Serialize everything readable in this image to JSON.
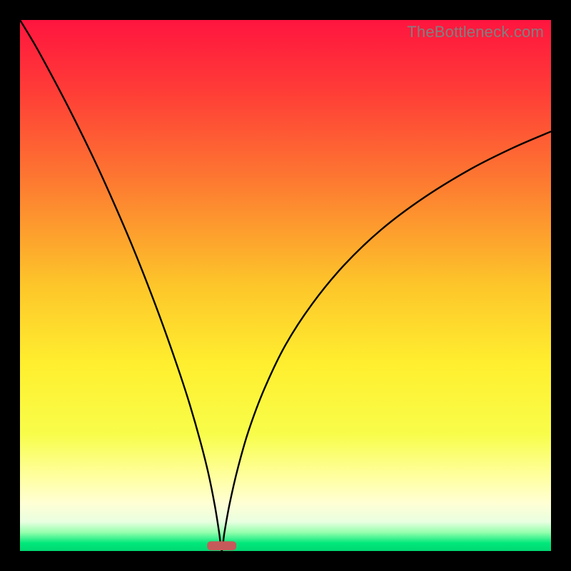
{
  "watermark": "TheBottleneck.com",
  "chart_data": {
    "type": "line",
    "title": "",
    "xlabel": "",
    "ylabel": "",
    "xlim": [
      0,
      1
    ],
    "ylim": [
      0,
      1
    ],
    "background_gradient": {
      "stops": [
        {
          "offset": 0.0,
          "color": "#ff153f"
        },
        {
          "offset": 0.13,
          "color": "#ff3b37"
        },
        {
          "offset": 0.3,
          "color": "#fd7831"
        },
        {
          "offset": 0.5,
          "color": "#fdc62a"
        },
        {
          "offset": 0.65,
          "color": "#ffef2f"
        },
        {
          "offset": 0.78,
          "color": "#f8fd4a"
        },
        {
          "offset": 0.86,
          "color": "#ffffa0"
        },
        {
          "offset": 0.91,
          "color": "#ffffd4"
        },
        {
          "offset": 0.945,
          "color": "#e9ffe0"
        },
        {
          "offset": 0.965,
          "color": "#95ffad"
        },
        {
          "offset": 0.985,
          "color": "#00e87a"
        },
        {
          "offset": 1.0,
          "color": "#00d873"
        }
      ]
    },
    "curve": {
      "description": "V-shaped bottleneck curve touching y=0 at the minimum",
      "min_x": 0.38,
      "points": [
        {
          "x": 0.0,
          "y": 1.0
        },
        {
          "x": 0.03,
          "y": 0.95
        },
        {
          "x": 0.06,
          "y": 0.895
        },
        {
          "x": 0.09,
          "y": 0.838
        },
        {
          "x": 0.12,
          "y": 0.778
        },
        {
          "x": 0.15,
          "y": 0.715
        },
        {
          "x": 0.18,
          "y": 0.648
        },
        {
          "x": 0.21,
          "y": 0.578
        },
        {
          "x": 0.24,
          "y": 0.503
        },
        {
          "x": 0.27,
          "y": 0.423
        },
        {
          "x": 0.3,
          "y": 0.337
        },
        {
          "x": 0.32,
          "y": 0.275
        },
        {
          "x": 0.34,
          "y": 0.205
        },
        {
          "x": 0.355,
          "y": 0.145
        },
        {
          "x": 0.367,
          "y": 0.085
        },
        {
          "x": 0.375,
          "y": 0.035
        },
        {
          "x": 0.38,
          "y": 0.0
        },
        {
          "x": 0.385,
          "y": 0.035
        },
        {
          "x": 0.395,
          "y": 0.09
        },
        {
          "x": 0.41,
          "y": 0.155
        },
        {
          "x": 0.43,
          "y": 0.225
        },
        {
          "x": 0.46,
          "y": 0.305
        },
        {
          "x": 0.5,
          "y": 0.388
        },
        {
          "x": 0.55,
          "y": 0.465
        },
        {
          "x": 0.61,
          "y": 0.538
        },
        {
          "x": 0.68,
          "y": 0.605
        },
        {
          "x": 0.76,
          "y": 0.665
        },
        {
          "x": 0.85,
          "y": 0.72
        },
        {
          "x": 0.93,
          "y": 0.76
        },
        {
          "x": 1.0,
          "y": 0.79
        }
      ]
    },
    "marker": {
      "x": 0.38,
      "width": 0.055,
      "height": 0.017,
      "color": "#c65a5a"
    }
  }
}
